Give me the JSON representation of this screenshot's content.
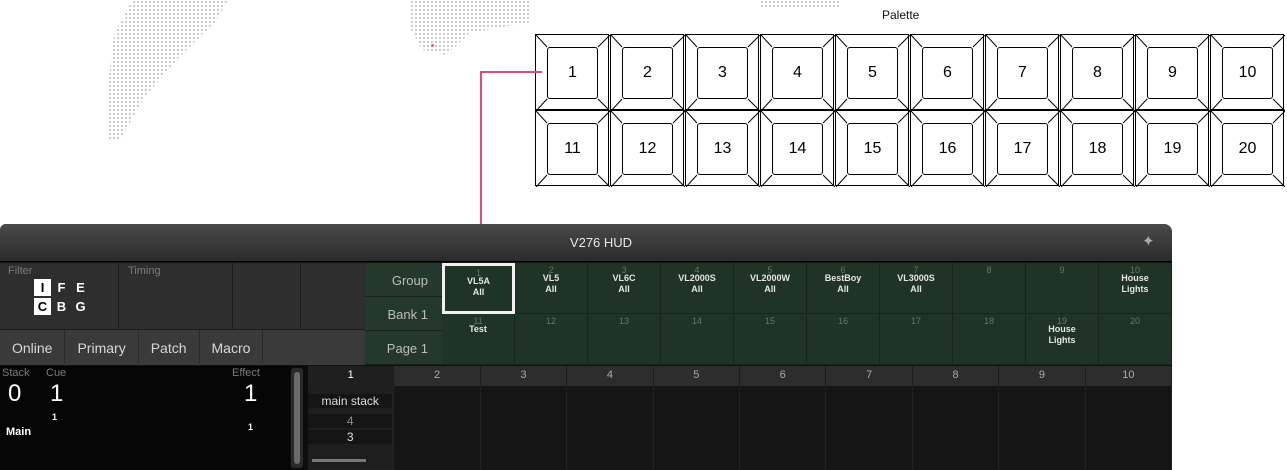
{
  "palette": {
    "title": "Palette",
    "keys": [
      "1",
      "2",
      "3",
      "4",
      "5",
      "6",
      "7",
      "8",
      "9",
      "10",
      "11",
      "12",
      "13",
      "14",
      "15",
      "16",
      "17",
      "18",
      "19",
      "20"
    ]
  },
  "hud": {
    "title": "V276 HUD",
    "filter_label": "Filter",
    "timing_label": "Timing",
    "filter_letters": [
      [
        "I",
        "F",
        "E"
      ],
      [
        "C",
        "B",
        "G"
      ]
    ],
    "tabs": [
      "Online",
      "Primary",
      "Patch",
      "Macro"
    ],
    "group_label": "Group",
    "bank_label": "Bank 1",
    "page_label": "Page 1",
    "grid": [
      {
        "num": "1",
        "label": "VL5A\nAll"
      },
      {
        "num": "2",
        "label": "VL5\nAll"
      },
      {
        "num": "3",
        "label": "VL6C\nAll"
      },
      {
        "num": "4",
        "label": "VL2000S\nAll"
      },
      {
        "num": "5",
        "label": "VL2000W\nAll"
      },
      {
        "num": "6",
        "label": "BestBoy\nAll"
      },
      {
        "num": "7",
        "label": "VL3000S\nAll"
      },
      {
        "num": "8",
        "label": ""
      },
      {
        "num": "9",
        "label": ""
      },
      {
        "num": "10",
        "label": "House\nLights"
      },
      {
        "num": "11",
        "label": "Test"
      },
      {
        "num": "12",
        "label": ""
      },
      {
        "num": "13",
        "label": ""
      },
      {
        "num": "14",
        "label": ""
      },
      {
        "num": "15",
        "label": ""
      },
      {
        "num": "16",
        "label": ""
      },
      {
        "num": "17",
        "label": ""
      },
      {
        "num": "18",
        "label": ""
      },
      {
        "num": "19",
        "label": "House\nLights"
      },
      {
        "num": "20",
        "label": ""
      }
    ],
    "stack_label": "Stack",
    "cue_label": "Cue",
    "effect_label": "Effect",
    "stack_value": "0",
    "cue_value": "1",
    "cue_sub": "1",
    "effect_value": "1",
    "effect_sub": "1",
    "main_label": "Main",
    "columns": [
      "1",
      "2",
      "3",
      "4",
      "5",
      "6",
      "7",
      "8",
      "9",
      "10"
    ],
    "slot1_name": "main stack",
    "slot1_a": "4",
    "slot1_b": "3"
  }
}
